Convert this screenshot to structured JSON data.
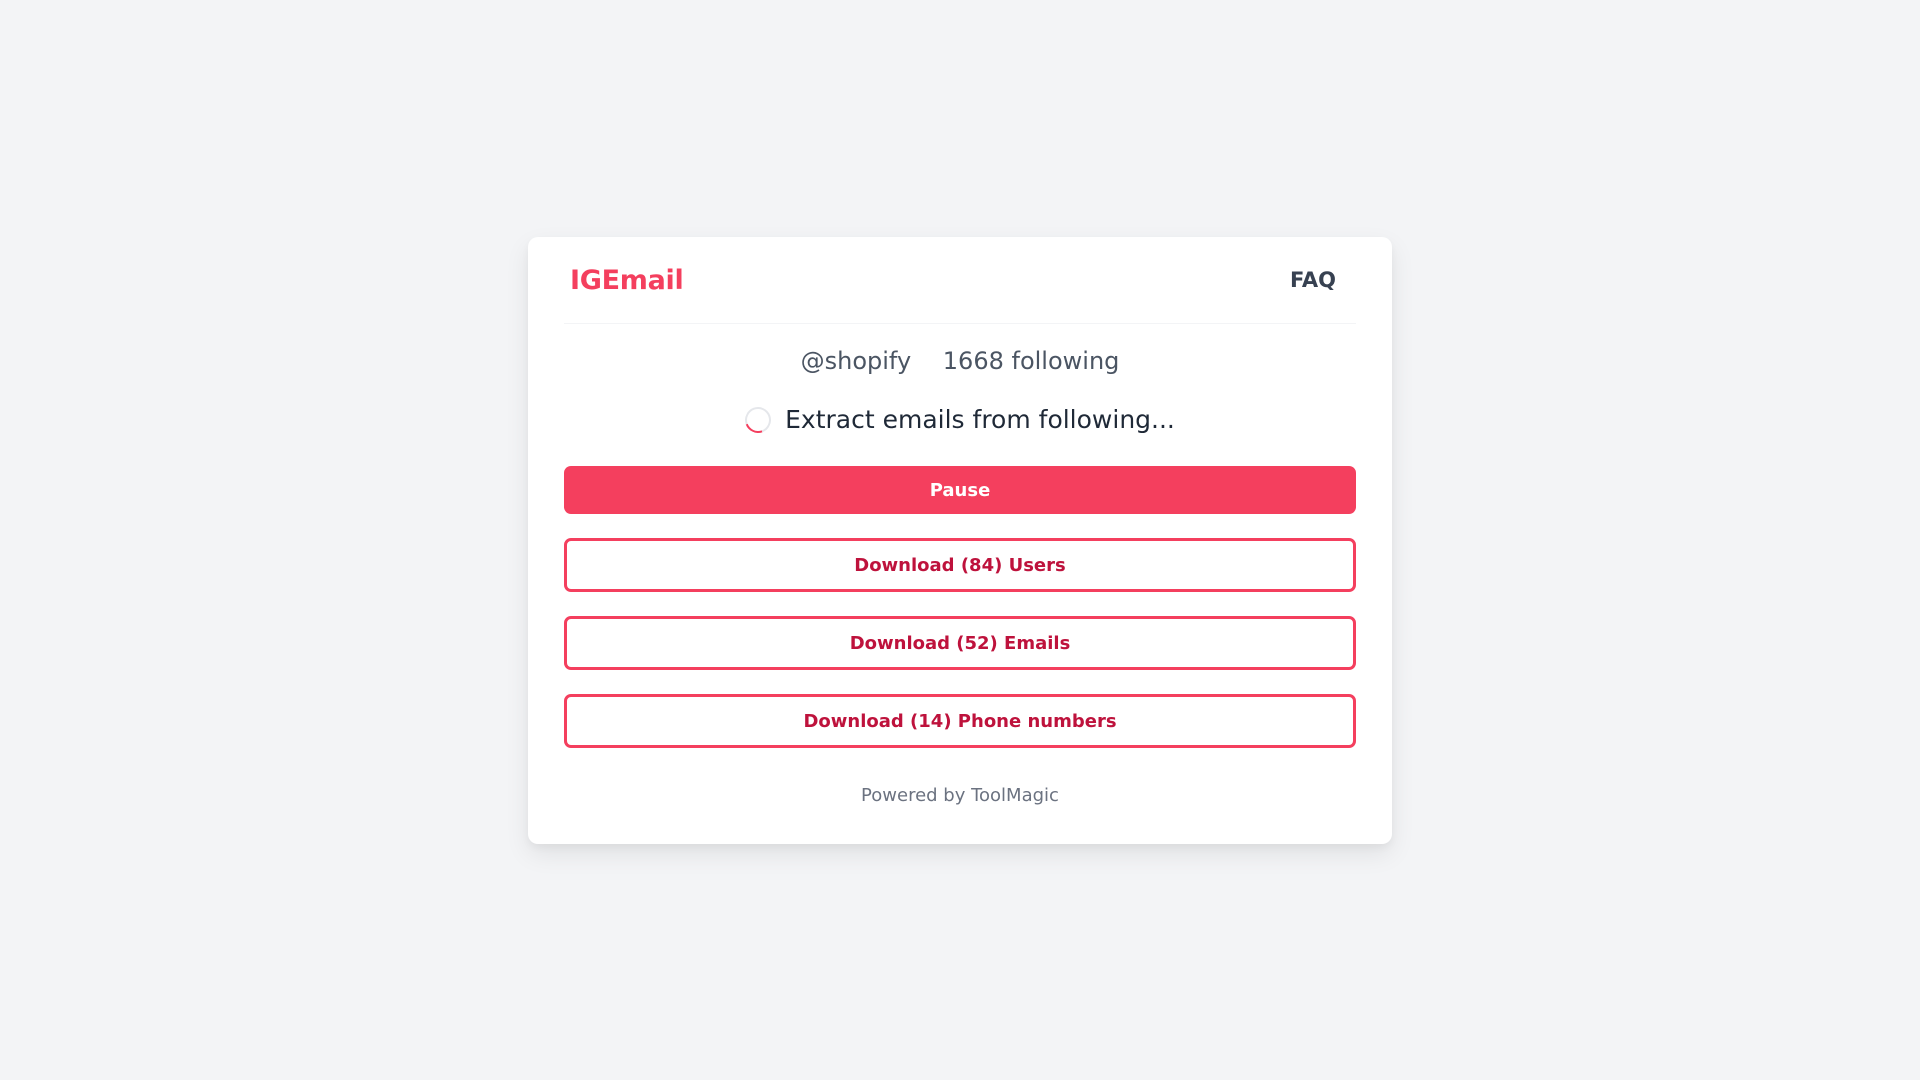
{
  "header": {
    "brand": "IGEmail",
    "faq_label": "FAQ"
  },
  "profile": {
    "handle": "@shopify",
    "following_text": "1668 following"
  },
  "status": {
    "icon": "spinner-icon",
    "text": "Extract emails from following..."
  },
  "actions": {
    "pause_label": "Pause",
    "download_users_label": "Download (84) Users",
    "download_emails_label": "Download (52) Emails",
    "download_phones_label": "Download (14) Phone numbers"
  },
  "footer": {
    "powered_by": "Powered by ToolMagic"
  },
  "colors": {
    "accent": "#f43f5e",
    "accent_text": "#be123c",
    "background": "#f3f4f6"
  }
}
